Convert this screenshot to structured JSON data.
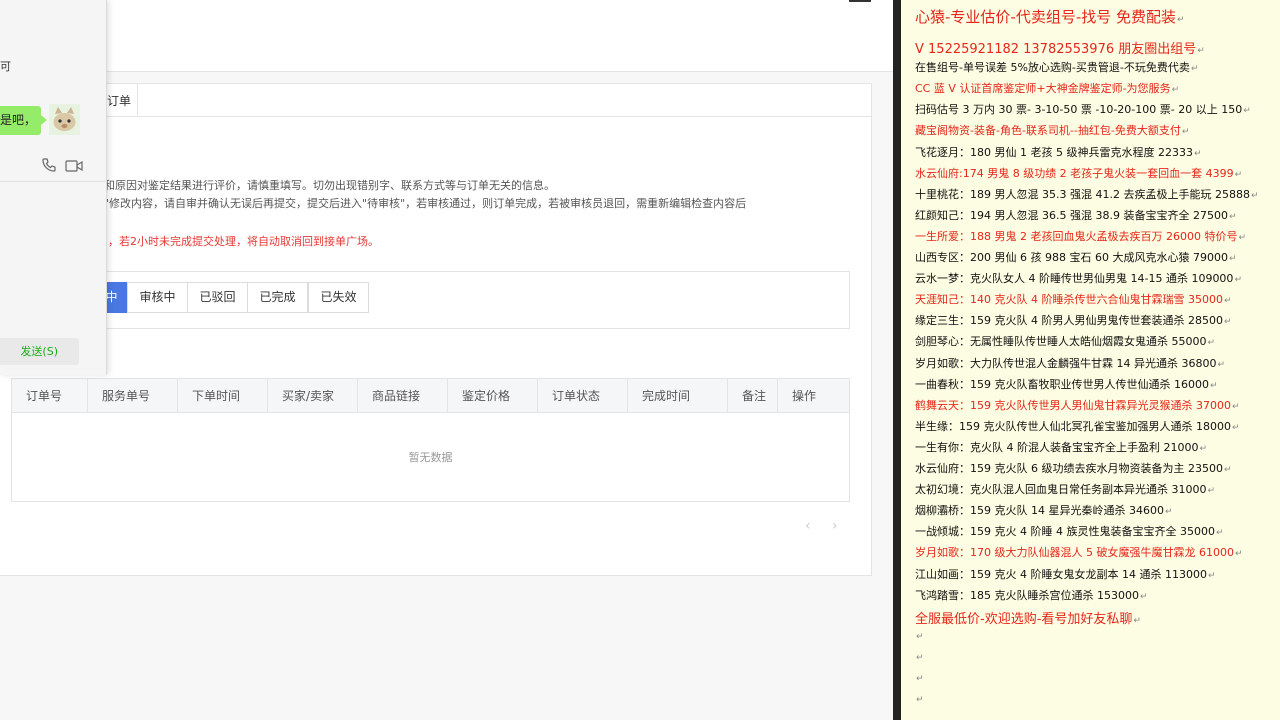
{
  "main": {
    "tab_label": "订单",
    "notices": [
      "格和原因对鉴定结果进行评价，请慎重填写。切勿出现错别字、联系方式等与订单无关的信息。",
      "辑\"修改内容，请自审并确认无误后再提交，提交后进入\"待审核\"，若审核通过，则订单完成，若被审核员退回，需重新编辑检查内容后",
      "，若2小时未完成提交处理，将自动取消回到接单广场。"
    ],
    "status_tabs": [
      "中",
      "审核中",
      "已驳回",
      "已完成",
      "已失效"
    ],
    "table_headers": [
      "订单号",
      "服务单号",
      "下单时间",
      "买家/卖家",
      "商品链接",
      "鉴定价格",
      "订单状态",
      "完成时间",
      "备注",
      "操作"
    ],
    "empty_text": "暂无数据",
    "pager_prev": "‹",
    "pager_next": "›"
  },
  "chat": {
    "mini_text": "可",
    "bubble_text": "是吧，",
    "send_label": "发送(S)",
    "icons": [
      "phone-icon",
      "video-icon"
    ]
  },
  "doc": {
    "lines": [
      {
        "text": "心猿-专业估价-代卖组号-找号 免费配装",
        "style": "red big"
      },
      {
        "text": "V 15225921182   13782553976 朋友圈出组号",
        "style": "red mid"
      },
      {
        "text": "在售组号-单号误差 5%放心选购-买贵管退-不玩免费代卖",
        "style": ""
      },
      {
        "text": "CC 蓝 V 认证首席鉴定师+大神金牌鉴定师-为您服务",
        "style": "red"
      },
      {
        "text": "扫码估号 3 万内 30 票- 3-10-50 票  -10-20-100 票- 20 以上 150",
        "style": ""
      },
      {
        "text": "藏宝阁物资-装备-角色-联系司机--抽红包-免费大额支付",
        "style": "red"
      },
      {
        "text": "飞花逐月：180 男仙 1 老孩 5 级神兵雷克水程度 22333",
        "style": ""
      },
      {
        "text": "水云仙府:174 男鬼 8 级功绩 2 老孩子鬼火装一套回血一套 4399",
        "style": "red"
      },
      {
        "text": "十里桃花：189 男人忽混 35.3 强混 41.2 去疾孟极上手能玩 25888",
        "style": ""
      },
      {
        "text": "红颜知己：194 男人忽混 36.5 强混 38.9 装备宝宝齐全 27500",
        "style": ""
      },
      {
        "text": "一生所爱：188 男鬼 2 老孩回血鬼火孟极去疾百万 26000 特价号",
        "style": "red"
      },
      {
        "text": "山西专区：200 男仙 6 孩 988 宝石 60 大成风克水心猿 79000",
        "style": ""
      },
      {
        "text": "云水一梦：克火队女人 4 阶睡传世男仙男鬼 14-15 通杀 109000",
        "style": ""
      },
      {
        "text": "天涯知己：140 克火队 4 阶睡杀传世六合仙鬼甘霖瑞雪 35000",
        "style": "red"
      },
      {
        "text": "缘定三生：159 克火队 4 阶男人男仙男鬼传世套装通杀 28500",
        "style": ""
      },
      {
        "text": "剑胆琴心：无属性睡队传世睡人太皓仙烟霞女鬼通杀 55000",
        "style": ""
      },
      {
        "text": "岁月如歌：大力队传世混人金麟强牛甘霖 14 异光通杀 36800",
        "style": ""
      },
      {
        "text": "一曲春秋：159 克火队畜牧职业传世男人传世仙通杀 16000",
        "style": ""
      },
      {
        "text": "鹤舞云天：159 克火队传世男人男仙鬼甘霖异光灵猴通杀 37000",
        "style": "red"
      },
      {
        "text": "半生缘：159 克火队传世人仙北冥孔雀宝鉴加强男人通杀 18000",
        "style": ""
      },
      {
        "text": "一生有你：克火队 4 阶混人装备宝宝齐全上手盈利 21000",
        "style": ""
      },
      {
        "text": "水云仙府：159 克火队 6 级功绩去疾水月物资装备为主 23500",
        "style": ""
      },
      {
        "text": "太初幻境：克火队混人回血鬼日常任务副本异光通杀 31000",
        "style": ""
      },
      {
        "text": "烟柳灞桥：159 克火队 14 星异光秦岭通杀 34600",
        "style": ""
      },
      {
        "text": "一战倾城：159 克火 4 阶睡 4 族灵性鬼装备宝宝齐全 35000",
        "style": ""
      },
      {
        "text": "岁月如歌：170 级大力队仙器混人 5 破女魔强牛魔甘霖龙 61000",
        "style": "red"
      },
      {
        "text": "江山如画：159 克火 4 阶睡女鬼女龙副本 14 通杀 113000",
        "style": ""
      },
      {
        "text": "飞鸿踏雪：185 克火队睡杀宫位通杀 153000",
        "style": ""
      },
      {
        "text": "全服最低价-欢迎选购-看号加好友私聊",
        "style": "red mid"
      },
      {
        "text": "",
        "style": ""
      },
      {
        "text": "",
        "style": ""
      },
      {
        "text": "",
        "style": ""
      },
      {
        "text": "",
        "style": ""
      }
    ],
    "return_mark": "↵"
  }
}
